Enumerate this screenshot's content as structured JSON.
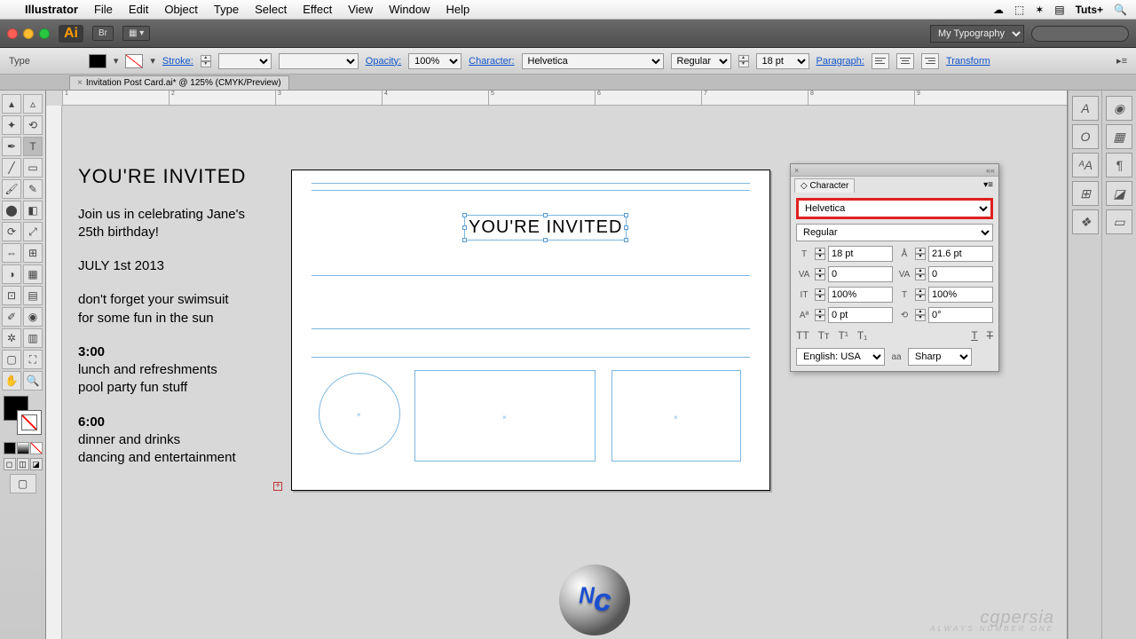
{
  "menubar": {
    "app": "Illustrator",
    "items": [
      "File",
      "Edit",
      "Object",
      "Type",
      "Select",
      "Effect",
      "View",
      "Window",
      "Help"
    ],
    "right": {
      "brand": "Tuts+"
    }
  },
  "appbar": {
    "workspace": "My Typography",
    "br": "Br"
  },
  "controlbar": {
    "toolLabel": "Type",
    "strokeLabel": "Stroke:",
    "strokeWeight": "",
    "opacityLabel": "Opacity:",
    "opacity": "100%",
    "characterLabel": "Character:",
    "fontFamily": "Helvetica",
    "fontStyle": "Regular",
    "fontSize": "18 pt",
    "paragraphLabel": "Paragraph:",
    "transformLabel": "Transform"
  },
  "tab": {
    "title": "Invitation Post Card.ai* @ 125% (CMYK/Preview)"
  },
  "ruler": {
    "ticks": [
      "1",
      "2",
      "3",
      "4",
      "5",
      "6",
      "7",
      "8",
      "9"
    ]
  },
  "sidetext": {
    "headline": "YOU'RE INVITED",
    "p1a": "Join us in celebrating Jane's",
    "p1b": "25th birthday!",
    "date": "JULY 1st 2013",
    "p2a": "don't forget your swimsuit",
    "p2b": "for some fun in the sun",
    "t1": "3:00",
    "t1a": "lunch and refreshments",
    "t1b": "pool party fun stuff",
    "t2": "6:00",
    "t2a": "dinner and drinks",
    "t2b": "dancing and entertainment"
  },
  "artboard": {
    "headline": "YOU'RE INVITED"
  },
  "charPanel": {
    "title": "Character",
    "fontFamily": "Helvetica",
    "fontStyle": "Regular",
    "fontSize": "18 pt",
    "leading": "21.6 pt",
    "kerning": "0",
    "tracking": "0",
    "vscale": "100%",
    "hscale": "100%",
    "baseline": "0 pt",
    "rotation": "0°",
    "language": "English: USA",
    "antialias": "Sharp"
  },
  "watermark": {
    "t1": "cgpersia",
    "t2": "ALWAYS NUMBER ONE"
  }
}
